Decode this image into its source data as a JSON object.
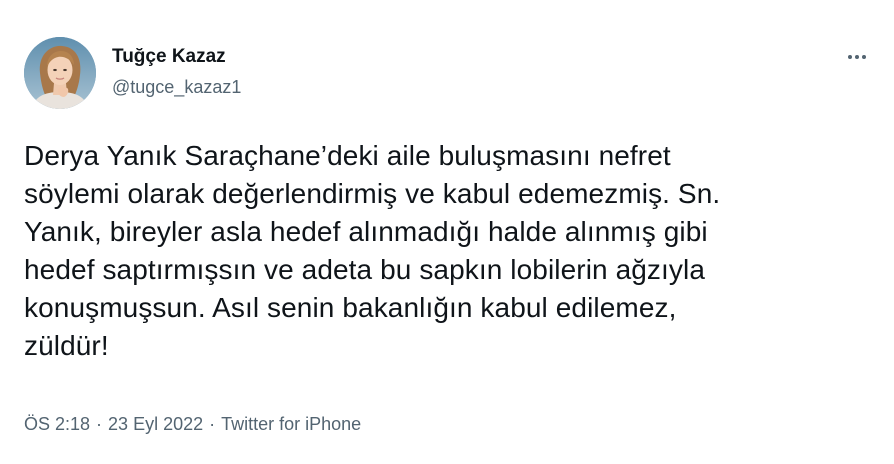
{
  "author": {
    "display_name": "Tuğçe Kazaz",
    "handle": "@tugce_kazaz1",
    "avatar_icon": "profile-photo"
  },
  "menu": {
    "more_icon": "more-options-icon"
  },
  "tweet": {
    "lines": [
      "Derya Yanık Saraçhane’deki aile buluşmasını nefret",
      "söylemi olarak değerlendirmiş ve kabul edemezmiş. Sn.",
      "Yanık, bireyler asla hedef alınmadığı halde alınmış gibi",
      "hedef saptırmışsın ve adeta bu sapkın lobilerin ağzıyla",
      "konuşmuşsun. Asıl senin bakanlığın kabul edilemez,",
      "züldür!"
    ]
  },
  "meta": {
    "time": "ÖS 2:18",
    "separator": "·",
    "date": "23 Eyl 2022",
    "source": "Twitter for iPhone"
  },
  "colors": {
    "text": "#0f1419",
    "secondary": "#536471",
    "background": "#ffffff"
  }
}
